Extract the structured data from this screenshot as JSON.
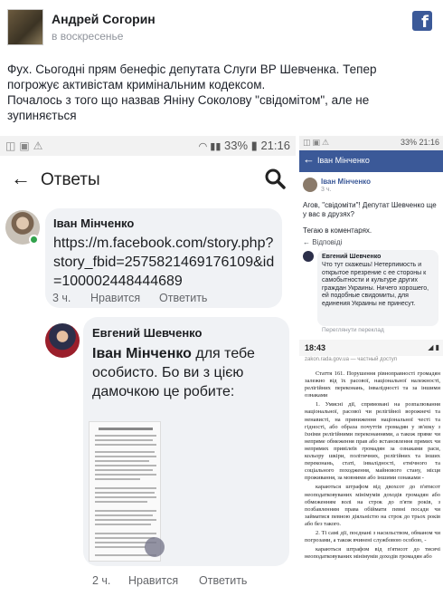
{
  "post": {
    "author": "Андрей Согорин",
    "time": "в воскресенье",
    "text_lines": [
      "Фух. Сьогодні прям бенефіс депутата Слуги ВР Шевченка. Тепер",
      "погрожує активістам кримінальним кодексом.",
      "Почалось з того що назвав Яніну Соколову \"свідомітом\", але не",
      "зупиняється"
    ],
    "fb_logo": "f"
  },
  "left_phone": {
    "status": {
      "battery": "33%",
      "time": "21:16"
    },
    "title": "Ответы",
    "comment1": {
      "author": "Іван Мінченко",
      "text": "https://m.facebook.com/story.php?story_fbid=2575821469176109&id=100002448444689",
      "time": "3 ч.",
      "like": "Нравится",
      "reply": "Ответить"
    },
    "comment2": {
      "author": "Евгений Шевченко",
      "mention": "Іван Мінченко",
      "text": " для тебе особисто. Бо ви з цією дамочкою це робите:",
      "time": "2 ч.",
      "like": "Нравится",
      "reply": "Ответить"
    }
  },
  "right_top_phone": {
    "status": {
      "battery": "33%",
      "time": "21:16"
    },
    "title": "Іван Мінченко",
    "post_author": "Іван Мінченко",
    "post_time": "3 ч.",
    "post_text": "Агов, \"свідоміти\"! Депутат Шевченко ще у вас в друзях?",
    "tag_text": "Тегаю в коментарях.",
    "replies_label": "Відповіді",
    "reply_author": "Евгений Шевченко",
    "reply_text": "Что тут скажешь! Нетерпимость и открытое презрение с ее стороны к самобытности и культуре других граждан Украины. Ничего хорошего, ей подобные свидомиты, для единения Украины не принесут.",
    "translate": "Переглянути переклад"
  },
  "right_bottom_phone": {
    "time": "18:43",
    "url": "zakon.rada.gov.ua — частный доступ",
    "paragraphs": [
      "Стаття 161. Порушення рівноправності громадян залежно від їх расової, національної належності, релігійних переконань, інвалідності та за іншими ознаками",
      "1. Умисні дії, спрямовані на розпалювання національної, расової чи релігійної ворожнечі та ненависті, на приниження національної честі та гідності, або образа почуттів громадян у зв'язку з їхніми релігійними переконаннями, а також пряме чи непряме обмеження прав або встановлення прямих чи непрямих привілеїв громадян за ознаками раси, кольору шкіри, політичних, релігійних та інших переконань, статі, інвалідності, етнічного та соціального походження, майнового стану, місця проживання, за мовними або іншими ознаками -",
      "караються штрафом від двохсот до п'ятисот неоподатковуваних мінімумів доходів громадян або обмеженням волі на строк до п'яти років, з позбавленням права обіймати певні посади чи займатися певною діяльністю на строк до трьох років або без такого.",
      "2. Ті самі дії, поєднані з насильством, обманом чи погрозами, а також вчинені службовою особою, -",
      "караються штрафом від п'ятисот до тисячі неоподатковуваних мінімумів доходів громадян або"
    ]
  }
}
